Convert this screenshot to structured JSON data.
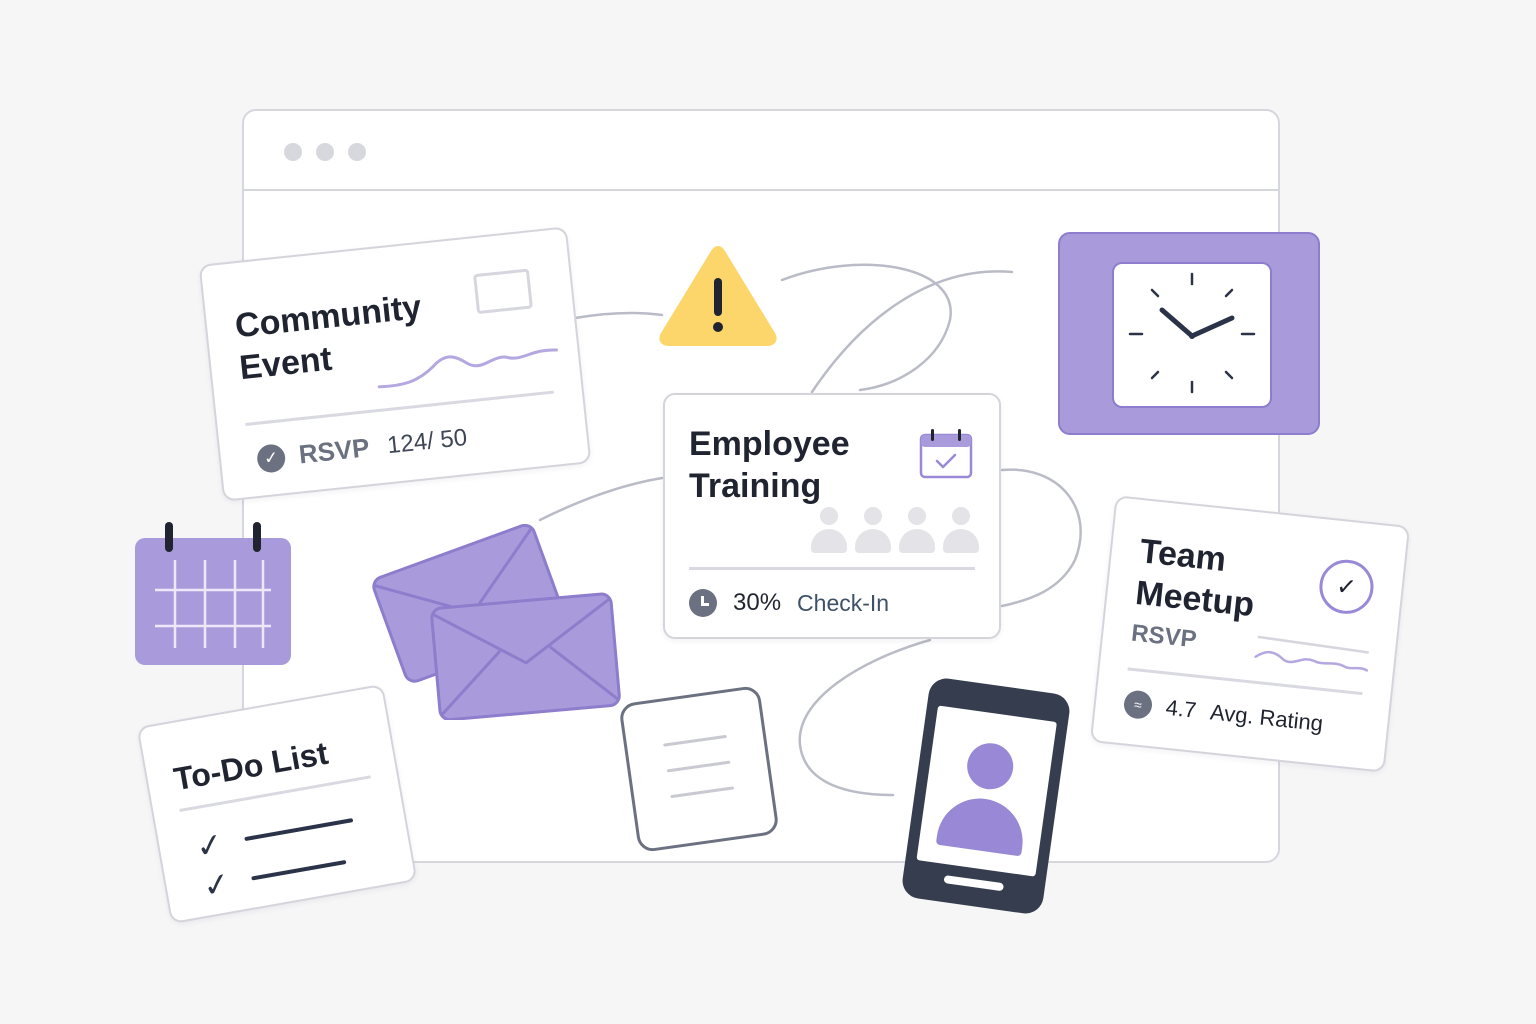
{
  "colors": {
    "accent": "#a99bdb",
    "accent_dark": "#8e7ccc",
    "warning": "#fcd66b",
    "ink": "#1f2430",
    "muted": "#6b7180",
    "border": "#d4d4dc",
    "phone": "#353d4f"
  },
  "browser": {
    "window_controls": [
      "dot",
      "dot",
      "dot"
    ]
  },
  "cards": {
    "community_event": {
      "title": "Community Event",
      "icon": "image-placeholder-icon",
      "rsvp_label": "RSVP",
      "rsvp_count": "124/ 50",
      "status_icon": "check-circle-icon"
    },
    "employee_training": {
      "title": "Employee Training",
      "icon": "calendar-check-icon",
      "attendees_icon": "people-icon",
      "progress_percent": "30%",
      "progress_value": 0.3,
      "action_label": "Check-In",
      "status_icon": "clock-icon"
    },
    "team_meetup": {
      "title": "Team Meetup",
      "rsvp_label": "RSVP",
      "status_icon": "check-ring-icon",
      "rating_value": "4.7",
      "rating_label": "Avg. Rating",
      "rating_icon": "rating-icon"
    },
    "todo": {
      "title": "To-Do List",
      "items_checked": [
        true,
        true
      ]
    }
  },
  "decorations": {
    "clock": "clock-icon",
    "calendar": "calendar-icon",
    "envelopes": "envelope-icon",
    "document": "document-icon",
    "warning": "warning-icon",
    "phone": "smartphone-profile-icon"
  }
}
